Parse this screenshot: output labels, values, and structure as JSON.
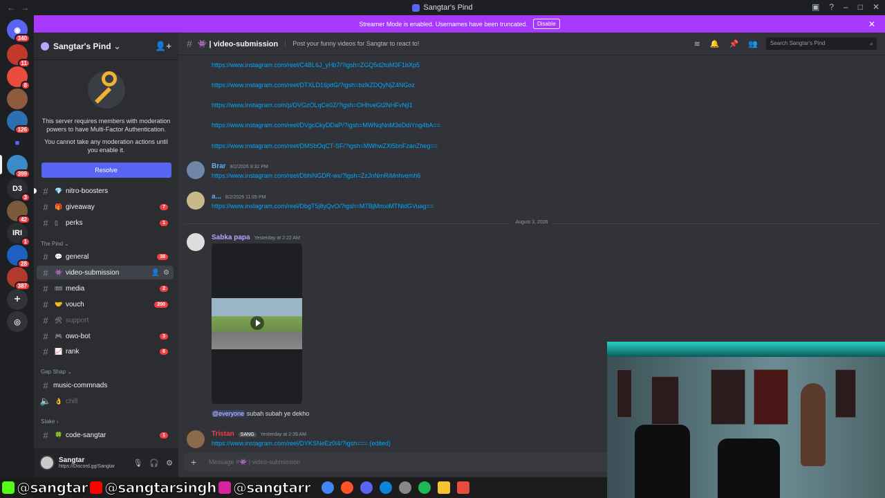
{
  "window": {
    "title": "Sangtar's Pind"
  },
  "banner": {
    "text": "Streamer Mode is enabled. Usernames have been truncated.",
    "disable_label": "Disable"
  },
  "rail": {
    "servers": [
      {
        "label": "",
        "badge": "340",
        "color": "#5865f2"
      },
      {
        "label": "",
        "badge": "11",
        "color": "#c0392b"
      },
      {
        "label": "",
        "badge": "8",
        "color": "#e74c3c"
      },
      {
        "label": "",
        "badge": "",
        "color": "#8e5a3c"
      },
      {
        "label": "",
        "badge": "126",
        "color": "#2c6fb3"
      },
      {
        "label": "",
        "badge": "",
        "color": "#4959d6"
      },
      {
        "label": "",
        "badge": "399",
        "color": "#3b8cc6"
      },
      {
        "label": "D3",
        "badge": "3",
        "color": "#2b2d31"
      },
      {
        "label": "",
        "badge": "42",
        "color": "#7a5a3a"
      },
      {
        "label": "IRI",
        "badge": "1",
        "color": "#2b2d31"
      },
      {
        "label": "",
        "badge": "28",
        "color": "#1f5fbf"
      },
      {
        "label": "",
        "badge": "387",
        "color": "#b03a2e"
      }
    ]
  },
  "sidebar": {
    "server_name": "Sangtar's Pind",
    "mfa_text_1": "This server requires members with moderation powers to have Multi-Factor Authentication.",
    "mfa_text_2": "You cannot take any moderation actions until you enable it.",
    "resolve_label": "Resolve",
    "channels_top": [
      {
        "name": "nitro-boosters",
        "emoji": "💎",
        "count": ""
      },
      {
        "name": "giveaway",
        "emoji": "🎁",
        "count": "7"
      },
      {
        "name": "perks",
        "emoji": "▯",
        "count": "1"
      }
    ],
    "cat_pind": "The Pind",
    "channels_pind": [
      {
        "name": "general",
        "emoji": "💬",
        "count": "38"
      },
      {
        "name": "video-submission",
        "emoji": "👾",
        "count": ""
      },
      {
        "name": "media",
        "emoji": "🎟",
        "count": "2"
      },
      {
        "name": "vouch",
        "emoji": "🤝",
        "count": "200"
      },
      {
        "name": "support",
        "emoji": "🛠",
        "count": ""
      },
      {
        "name": "owo-bot",
        "emoji": "🎮",
        "count": "3"
      },
      {
        "name": "rank",
        "emoji": "📈",
        "count": "6"
      }
    ],
    "cat_gap": "Gap Shap",
    "channels_gap": [
      {
        "name": "music-commnads",
        "emoji": "",
        "count": ""
      },
      {
        "name": "chill",
        "emoji": "👌",
        "count": ""
      }
    ],
    "cat_stake": "Stake",
    "channels_stake": [
      {
        "name": "code-sangtar",
        "emoji": "🍀",
        "count": "1"
      }
    ],
    "user": {
      "name": "Sangtar",
      "sub": "https://Discord.gg/Sangtar"
    }
  },
  "channel": {
    "name": "video-submission",
    "topic": "Post your funny videos for Sangtar to react to!",
    "search_placeholder": "Search Sangtar's Pind",
    "composer_placeholder": "Message #👾 | video-submission"
  },
  "messages": {
    "links_top": [
      "https://www.instagram.com/reel/C4BL6J_yHb7/?igsh=ZGQ5d2tuM3F1bXp5",
      "https://www.instagram.com/reel/DTXLD16jxtG/?igsh=bzlkZDQyNjZ4NGoz",
      "https://www.instagram.com/p/DVGzOLqCe0Z/?igsh=OHhveGt2NHFvNjl1",
      "https://www.instagram.com/reel/DVgcCkyDDaP/?igsh=MWNqNnM3eDdiYng4bA==",
      "https://www.instagram.com/reel/DMSbOqCT-SF/?igsh=MWhwZXl5bnFzanZheg=="
    ],
    "brar": {
      "author": "Brar",
      "time": "8/2/2026 9:32 PM",
      "link": "https://www.instagram.com/reel/DbhiNGDR-wx/?igsh=ZzJnNmRiMnhvemh6"
    },
    "a": {
      "author": "a...",
      "time": "8/2/2026 11:05 PM",
      "link": "https://www.instagram.com/reel/DbgT5j8yQvO/?igsh=MTBjMmxiMTNldGVuag=="
    },
    "date_divider": "August 3, 2026",
    "sabka": {
      "author": "Sabka papa",
      "time": "Yesterday at 2:22 AM",
      "mention": "@everyone",
      "text": "subah subah ye dekho"
    },
    "tristan": {
      "author": "Tristan",
      "tag": "SANG",
      "time": "Yesterday at 2:39 AM",
      "link": "https://www.instagram.com/reel/DYKSNeEz0l4/?igsh=== (edited)"
    }
  },
  "overlay": {
    "handle_1": "@sangtar",
    "handle_2": "@sangtarsingh",
    "handle_3": "@sangtarr"
  },
  "colors": {
    "accent": "#5865f2",
    "banner": "#a838ff",
    "link": "#00a8fc",
    "badge": "#f23f43"
  }
}
